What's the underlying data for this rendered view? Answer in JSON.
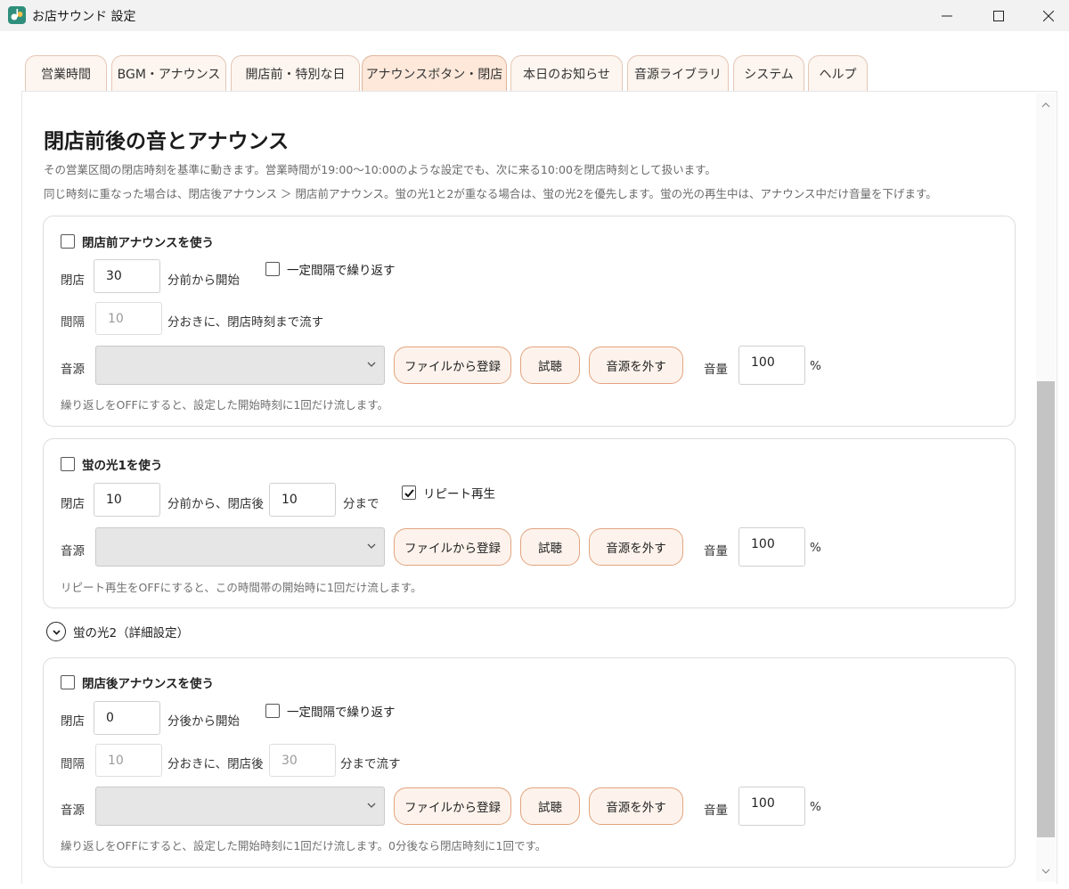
{
  "window": {
    "title": "お店サウンド 設定"
  },
  "tabs": [
    {
      "label": "営業時間"
    },
    {
      "label": "BGM・アナウンス"
    },
    {
      "label": "開店前・特別な日"
    },
    {
      "label": "アナウンスボタン・閉店",
      "active": true
    },
    {
      "label": "本日のお知らせ"
    },
    {
      "label": "音源ライブラリ"
    },
    {
      "label": "システム"
    },
    {
      "label": "ヘルプ"
    }
  ],
  "page": {
    "title": "閉店前後の音とアナウンス",
    "desc1": "その営業区間の閉店時刻を基準に動きます。営業時間が19:00〜10:00のような設定でも、次に来る10:00を閉店時刻として扱います。",
    "desc2": "同じ時刻に重なった場合は、閉店後アナウンス ＞ 閉店前アナウンス。蛍の光1と2が重なる場合は、蛍の光2を優先します。蛍の光の再生中は、アナウンス中だけ音量を下げます。"
  },
  "common": {
    "source_label": "音源",
    "register_button": "ファイルから登録",
    "preview_button": "試聴",
    "remove_button": "音源を外す",
    "volume_label": "音量",
    "percent": "%",
    "close_label": "閉店",
    "interval_label": "間隔",
    "repeat_interval_label": "一定間隔で繰り返す"
  },
  "pre_announce": {
    "enable_label": "閉店前アナウンスを使う",
    "enabled": false,
    "start_minutes": "30",
    "start_suffix": "分前から開始",
    "repeat_enabled": false,
    "interval_minutes": "10",
    "interval_suffix": "分おきに、閉店時刻まで流す",
    "source_value": "",
    "volume": "100",
    "hint": "繰り返しをOFFにすると、設定した開始時刻に1回だけ流します。"
  },
  "hotaru1": {
    "enable_label": "蛍の光1を使う",
    "enabled": false,
    "before_minutes": "10",
    "before_suffix": "分前から、閉店後",
    "after_minutes": "10",
    "after_suffix": "分まで",
    "repeat_label": "リピート再生",
    "repeat_enabled": true,
    "source_value": "",
    "volume": "100",
    "hint": "リピート再生をOFFにすると、この時間帯の開始時に1回だけ流します。"
  },
  "hotaru2": {
    "expander_label": "蛍の光2（詳細設定）"
  },
  "post_announce": {
    "enable_label": "閉店後アナウンスを使う",
    "enabled": false,
    "start_minutes": "0",
    "start_suffix": "分後から開始",
    "repeat_enabled": false,
    "interval_minutes": "10",
    "interval_suffix": "分おきに、閉店後",
    "until_minutes": "30",
    "until_suffix": "分まで流す",
    "source_value": "",
    "volume": "100",
    "hint": "繰り返しをOFFにすると、設定した開始時刻に1回だけ流します。0分後なら閉店時刻に1回です。"
  }
}
